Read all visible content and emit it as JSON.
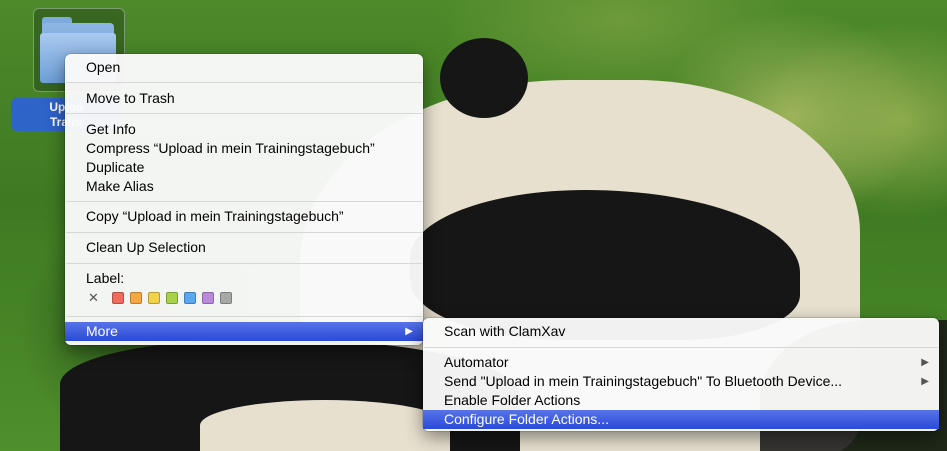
{
  "desktop": {
    "folder_label_line1": "Uploa",
    "folder_label_line2": "Traini"
  },
  "context_menu": {
    "items": [
      {
        "label": "Open"
      },
      {
        "label": "Move to Trash"
      },
      {
        "label": "Get Info"
      },
      {
        "label": "Compress “Upload in mein Trainingstagebuch”"
      },
      {
        "label": "Duplicate"
      },
      {
        "label": "Make Alias"
      },
      {
        "label": "Copy “Upload in mein Trainingstagebuch”"
      },
      {
        "label": "Clean Up Selection"
      },
      {
        "label": "Label:"
      },
      {
        "label": "More"
      }
    ],
    "label_none_symbol": "✕",
    "label_colors": [
      "#f06a5e",
      "#f5a742",
      "#f1d24b",
      "#a9d24c",
      "#5aa8f0",
      "#b98ad9",
      "#a8a8a8"
    ],
    "highlight_color": "#3a5be0"
  },
  "submenu": {
    "items": [
      {
        "label": "Scan with ClamXav"
      },
      {
        "label": "Automator"
      },
      {
        "label": "Send \"Upload in mein Trainingstagebuch\" To Bluetooth Device..."
      },
      {
        "label": "Enable Folder Actions"
      },
      {
        "label": "Configure Folder Actions..."
      }
    ],
    "arrow_symbol": "▶"
  }
}
